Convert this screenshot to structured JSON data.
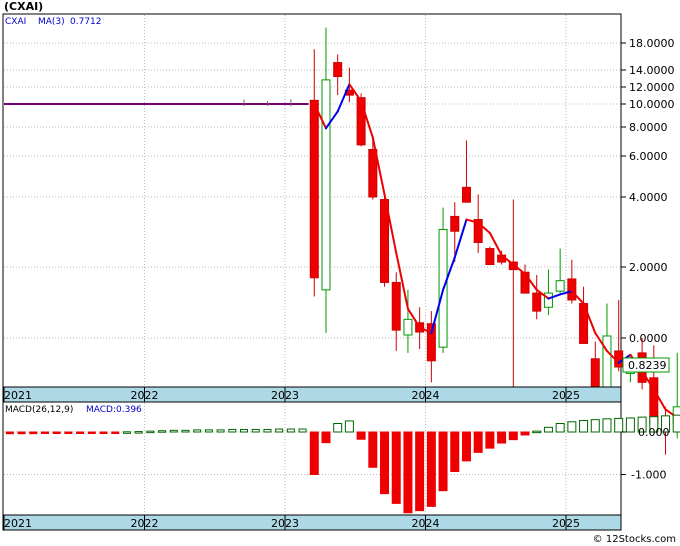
{
  "chart_data": [
    {
      "type": "candlestick",
      "title": "(CXAI)",
      "legend": [
        {
          "label": "CXAI",
          "color": "#0000cc"
        },
        {
          "label": "MA(3)",
          "color": "#0000cc"
        },
        {
          "label": "0.7712",
          "color": "#0000cc"
        }
      ],
      "y_scale": "log",
      "y_tick_labels": [
        "18.0000",
        "14.0000",
        "12.0000",
        "10.0000",
        "8.0000",
        "6.0000",
        "4.0000",
        "2.0000",
        "0.0000"
      ],
      "x_tick_labels": [
        "2021",
        "2022",
        "2023",
        "2024",
        "2025"
      ],
      "last_price_label": "0.8239",
      "colors": {
        "up": "#ffffff",
        "down": "#ee0000",
        "ma_up": "#0000ee",
        "ma_down": "#ee0000",
        "axis_band": "#add8e6"
      },
      "candles": [
        {
          "date": "2023-03",
          "o": 10.4,
          "h": 17,
          "l": 1.5,
          "c": 1.8
        },
        {
          "date": "2023-04",
          "o": 1.6,
          "h": 21,
          "l": 1.05,
          "c": 12.8
        },
        {
          "date": "2023-05",
          "o": 15,
          "h": 16.2,
          "l": 11,
          "c": 13.2
        },
        {
          "date": "2023-06",
          "o": 11.6,
          "h": 14.3,
          "l": 10.2,
          "c": 11
        },
        {
          "date": "2023-07",
          "o": 10.7,
          "h": 11.2,
          "l": 6.6,
          "c": 6.7
        },
        {
          "date": "2023-08",
          "o": 6.4,
          "h": 7.2,
          "l": 3.9,
          "c": 4
        },
        {
          "date": "2023-09",
          "o": 3.9,
          "h": 4.1,
          "l": 1.65,
          "c": 1.72
        },
        {
          "date": "2023-10",
          "o": 1.72,
          "h": 1.9,
          "l": 0.93,
          "c": 1.08
        },
        {
          "date": "2023-11",
          "o": 1.03,
          "h": 1.6,
          "l": 0.92,
          "c": 1.2
        },
        {
          "date": "2023-12",
          "o": 1.16,
          "h": 1.35,
          "l": 0.94,
          "c": 1.06
        },
        {
          "date": "2024-01",
          "o": 1.15,
          "h": 1.3,
          "l": 0.78,
          "c": 0.88
        },
        {
          "date": "2024-02",
          "o": 0.95,
          "h": 3.6,
          "l": 0.92,
          "c": 2.9
        },
        {
          "date": "2024-03",
          "o": 3.3,
          "h": 3.8,
          "l": 2.1,
          "c": 2.85
        },
        {
          "date": "2024-04",
          "o": 4.4,
          "h": 7,
          "l": 3.9,
          "c": 3.8
        },
        {
          "date": "2024-05",
          "o": 3.2,
          "h": 4.1,
          "l": 2.3,
          "c": 2.55
        },
        {
          "date": "2024-06",
          "o": 2.4,
          "h": 2.45,
          "l": 2.05,
          "c": 2.05
        },
        {
          "date": "2024-07",
          "o": 2.25,
          "h": 2.35,
          "l": 2.05,
          "c": 2.1
        },
        {
          "date": "2024-08",
          "o": 2.1,
          "h": 3.9,
          "l": 0.75,
          "c": 1.95
        },
        {
          "date": "2024-09",
          "o": 1.9,
          "h": 2.05,
          "l": 1.55,
          "c": 1.55
        },
        {
          "date": "2024-10",
          "o": 1.55,
          "h": 1.85,
          "l": 1.2,
          "c": 1.3
        },
        {
          "date": "2024-11",
          "o": 1.35,
          "h": 1.95,
          "l": 1.25,
          "c": 1.55
        },
        {
          "date": "2024-12",
          "o": 1.58,
          "h": 2.4,
          "l": 1.55,
          "c": 1.75
        },
        {
          "date": "2025-01",
          "o": 1.78,
          "h": 2.15,
          "l": 1.4,
          "c": 1.45
        },
        {
          "date": "2025-02",
          "o": 1.4,
          "h": 1.65,
          "l": 0.97,
          "c": 0.97
        },
        {
          "date": "2025-03",
          "o": 0.89,
          "h": 0.98,
          "l": 0.66,
          "c": 0.73
        },
        {
          "date": "2025-04",
          "o": 0.74,
          "h": 1.4,
          "l": 0.71,
          "c": 1.02
        },
        {
          "date": "2025-05",
          "o": 0.93,
          "h": 1.45,
          "l": 0.83,
          "c": 0.85
        },
        {
          "date": "2025-06",
          "o": 0.82,
          "h": 0.9,
          "l": 0.78,
          "c": 0.86
        },
        {
          "date": "2025-07",
          "o": 0.92,
          "h": 1.0,
          "l": 0.75,
          "c": 0.78
        },
        {
          "date": "2025-08",
          "o": 0.8,
          "h": 0.96,
          "l": 0.6,
          "c": 0.62
        },
        {
          "date": "2025-09",
          "o": 0.62,
          "h": 0.68,
          "l": 0.52,
          "c": 0.61
        },
        {
          "date": "2025-10",
          "o": 0.62,
          "h": 0.92,
          "l": 0.57,
          "c": 0.68
        }
      ],
      "flat_segment": {
        "start": "2021-01",
        "end": "2023-02",
        "value": 10.0
      },
      "ma3": [
        {
          "date": "2023-03",
          "v": 10.0
        },
        {
          "date": "2023-04",
          "v": 7.9
        },
        {
          "date": "2023-05",
          "v": 9.3
        },
        {
          "date": "2023-06",
          "v": 12.3
        },
        {
          "date": "2023-07",
          "v": 10.3
        },
        {
          "date": "2023-08",
          "v": 7.2
        },
        {
          "date": "2023-09",
          "v": 4.1
        },
        {
          "date": "2023-10",
          "v": 2.3
        },
        {
          "date": "2023-11",
          "v": 1.33
        },
        {
          "date": "2023-12",
          "v": 1.11
        },
        {
          "date": "2024-01",
          "v": 1.05
        },
        {
          "date": "2024-02",
          "v": 1.6
        },
        {
          "date": "2024-03",
          "v": 2.2
        },
        {
          "date": "2024-04",
          "v": 3.2
        },
        {
          "date": "2024-05",
          "v": 3.1
        },
        {
          "date": "2024-06",
          "v": 2.8
        },
        {
          "date": "2024-07",
          "v": 2.25
        },
        {
          "date": "2024-08",
          "v": 2.05
        },
        {
          "date": "2024-09",
          "v": 1.87
        },
        {
          "date": "2024-10",
          "v": 1.6
        },
        {
          "date": "2024-11",
          "v": 1.47
        },
        {
          "date": "2024-12",
          "v": 1.53
        },
        {
          "date": "2025-01",
          "v": 1.58
        },
        {
          "date": "2025-02",
          "v": 1.4
        },
        {
          "date": "2025-03",
          "v": 1.05
        },
        {
          "date": "2025-04",
          "v": 0.93
        },
        {
          "date": "2025-05",
          "v": 0.87
        },
        {
          "date": "2025-06",
          "v": 0.91
        },
        {
          "date": "2025-07",
          "v": 0.83
        },
        {
          "date": "2025-08",
          "v": 0.75
        },
        {
          "date": "2025-09",
          "v": 0.67
        },
        {
          "date": "2025-10",
          "v": 0.64
        }
      ]
    },
    {
      "type": "bar",
      "title": "MACD(26,12,9)",
      "legend": [
        {
          "label": "MACD(26,12,9)",
          "color": "#000000"
        },
        {
          "label": "MACD:0.396",
          "color": "#0000cc"
        }
      ],
      "y_tick_labels": [
        "0.000",
        "-1.000"
      ],
      "ylim": [
        -1.9,
        0.45
      ],
      "x_tick_labels": [
        "2021",
        "2022",
        "2023",
        "2024",
        "2025"
      ],
      "colors": {
        "positive": "#006600",
        "negative": "#ee0000"
      },
      "monthly_bars": [
        {
          "date": "2021-01",
          "v": -0.04
        },
        {
          "date": "2021-02",
          "v": -0.04
        },
        {
          "date": "2021-03",
          "v": -0.04
        },
        {
          "date": "2021-04",
          "v": -0.03
        },
        {
          "date": "2021-05",
          "v": -0.03
        },
        {
          "date": "2021-06",
          "v": -0.02
        },
        {
          "date": "2021-07",
          "v": -0.02
        },
        {
          "date": "2021-08",
          "v": -0.01
        },
        {
          "date": "2021-09",
          "v": -0.01
        },
        {
          "date": "2021-10",
          "v": -0.01
        },
        {
          "date": "2021-11",
          "v": 0.005
        },
        {
          "date": "2021-12",
          "v": 0.01
        },
        {
          "date": "2022-01",
          "v": 0.02
        },
        {
          "date": "2022-02",
          "v": 0.03
        },
        {
          "date": "2022-03",
          "v": 0.04
        },
        {
          "date": "2022-04",
          "v": 0.04
        },
        {
          "date": "2022-05",
          "v": 0.05
        },
        {
          "date": "2022-06",
          "v": 0.05
        },
        {
          "date": "2022-07",
          "v": 0.05
        },
        {
          "date": "2022-08",
          "v": 0.06
        },
        {
          "date": "2022-09",
          "v": 0.06
        },
        {
          "date": "2022-10",
          "v": 0.06
        },
        {
          "date": "2022-11",
          "v": 0.06
        },
        {
          "date": "2022-12",
          "v": 0.07
        },
        {
          "date": "2023-01",
          "v": 0.07
        },
        {
          "date": "2023-02",
          "v": 0.07
        },
        {
          "date": "2023-03",
          "v": -1.0
        },
        {
          "date": "2023-04",
          "v": -0.25
        },
        {
          "date": "2023-05",
          "v": 0.2
        },
        {
          "date": "2023-06",
          "v": 0.26
        },
        {
          "date": "2023-07",
          "v": -0.17
        },
        {
          "date": "2023-08",
          "v": -0.83
        },
        {
          "date": "2023-09",
          "v": -1.45
        },
        {
          "date": "2023-10",
          "v": -1.68
        },
        {
          "date": "2023-11",
          "v": -1.9
        },
        {
          "date": "2023-12",
          "v": -1.85
        },
        {
          "date": "2024-01",
          "v": -1.75
        },
        {
          "date": "2024-02",
          "v": -1.38
        },
        {
          "date": "2024-03",
          "v": -0.93
        },
        {
          "date": "2024-04",
          "v": -0.68
        },
        {
          "date": "2024-05",
          "v": -0.48
        },
        {
          "date": "2024-06",
          "v": -0.38
        },
        {
          "date": "2024-07",
          "v": -0.26
        },
        {
          "date": "2024-08",
          "v": -0.18
        },
        {
          "date": "2024-09",
          "v": -0.07
        },
        {
          "date": "2024-10",
          "v": 0.02
        },
        {
          "date": "2024-11",
          "v": 0.11
        },
        {
          "date": "2024-12",
          "v": 0.2
        },
        {
          "date": "2025-01",
          "v": 0.24
        },
        {
          "date": "2025-02",
          "v": 0.27
        },
        {
          "date": "2025-03",
          "v": 0.29
        },
        {
          "date": "2025-04",
          "v": 0.31
        },
        {
          "date": "2025-05",
          "v": 0.32
        },
        {
          "date": "2025-06",
          "v": 0.33
        },
        {
          "date": "2025-07",
          "v": 0.35
        },
        {
          "date": "2025-08",
          "v": 0.36
        },
        {
          "date": "2025-09",
          "v": 0.38
        },
        {
          "date": "2025-10",
          "v": 0.396
        }
      ]
    }
  ],
  "footer": {
    "credit": "© 12Stocks.com"
  }
}
